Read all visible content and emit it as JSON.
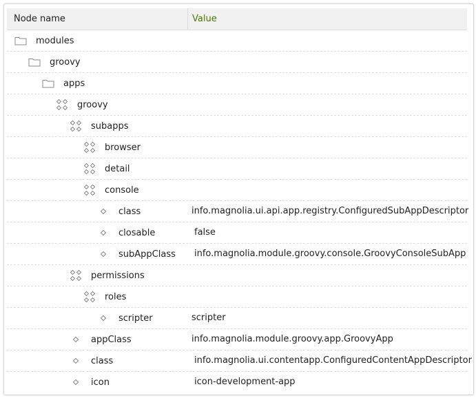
{
  "columns": {
    "node_name": "Node name",
    "value": "Value"
  },
  "rows": [
    {
      "name": "modules",
      "icon": "folder-icon",
      "value": ""
    },
    {
      "name": "groovy",
      "icon": "folder-icon",
      "value": ""
    },
    {
      "name": "apps",
      "icon": "folder-icon",
      "value": ""
    },
    {
      "name": "groovy",
      "icon": "content-node-icon",
      "value": ""
    },
    {
      "name": "subapps",
      "icon": "content-node-icon",
      "value": ""
    },
    {
      "name": "browser",
      "icon": "content-node-icon",
      "value": ""
    },
    {
      "name": "detail",
      "icon": "content-node-icon",
      "value": ""
    },
    {
      "name": "console",
      "icon": "content-node-icon",
      "value": ""
    },
    {
      "name": "class",
      "icon": "property-icon",
      "value": "info.magnolia.ui.api.app.registry.ConfiguredSubAppDescriptor"
    },
    {
      "name": "closable",
      "icon": "property-icon",
      "value": "false"
    },
    {
      "name": "subAppClass",
      "icon": "property-icon",
      "value": "info.magnolia.module.groovy.console.GroovyConsoleSubApp"
    },
    {
      "name": "permissions",
      "icon": "content-node-icon",
      "value": ""
    },
    {
      "name": "roles",
      "icon": "content-node-icon",
      "value": ""
    },
    {
      "name": "scripter",
      "icon": "property-icon",
      "value": "scripter"
    },
    {
      "name": "appClass",
      "icon": "property-icon",
      "value": "info.magnolia.module.groovy.app.GroovyApp"
    },
    {
      "name": "class",
      "icon": "property-icon",
      "value": "info.magnolia.ui.contentapp.ConfiguredContentAppDescriptor"
    },
    {
      "name": "icon",
      "icon": "property-icon",
      "value": "icon-development-app"
    }
  ]
}
